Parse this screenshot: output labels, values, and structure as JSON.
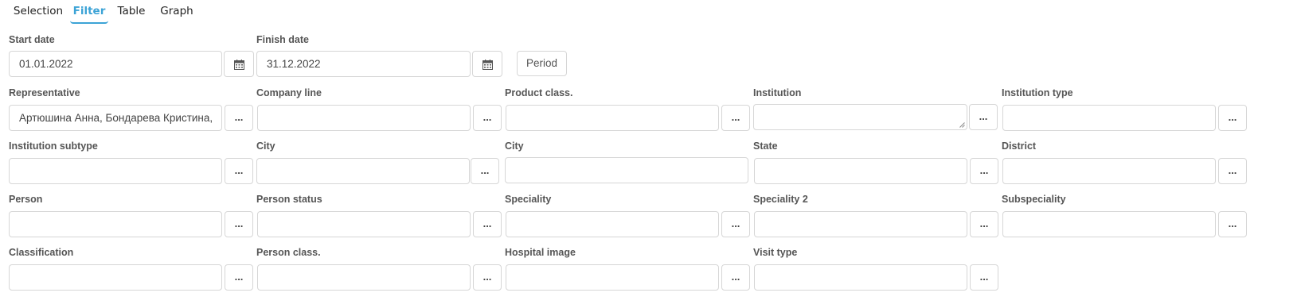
{
  "tabs": [
    {
      "label": "Selection",
      "active": false
    },
    {
      "label": "Filter",
      "active": true
    },
    {
      "label": "Table",
      "active": false
    },
    {
      "label": "Graph",
      "active": false
    }
  ],
  "dates": {
    "start_label": "Start date",
    "start_value": "01.01.2022",
    "finish_label": "Finish date",
    "finish_value": "31.12.2022",
    "period_label": "Period"
  },
  "filters": [
    {
      "label": "Representative",
      "value": "Артюшина Анна, Бондарева Кристина,",
      "button": "..."
    },
    {
      "label": "Company line",
      "value": "",
      "button": "..."
    },
    {
      "label": "Product class.",
      "value": "",
      "button": "..."
    },
    {
      "label": "Institution",
      "value": "",
      "button": "..."
    },
    {
      "label": "Institution type",
      "value": "",
      "button": "..."
    },
    {
      "label": "Institution subtype",
      "value": "",
      "button": "..."
    },
    {
      "label": "City",
      "value": "",
      "button": "..."
    },
    {
      "label": "City",
      "value": ""
    },
    {
      "label": "State",
      "value": "",
      "button": "..."
    },
    {
      "label": "District",
      "value": "",
      "button": "..."
    },
    {
      "label": "Person",
      "value": "",
      "button": "..."
    },
    {
      "label": "Person status",
      "value": "",
      "button": "..."
    },
    {
      "label": "Speciality",
      "value": "",
      "button": "..."
    },
    {
      "label": "Speciality 2",
      "value": "",
      "button": "..."
    },
    {
      "label": "Subspeciality",
      "value": "",
      "button": "..."
    },
    {
      "label": "Classification",
      "value": "",
      "button": "..."
    },
    {
      "label": "Person class.",
      "value": "",
      "button": "..."
    },
    {
      "label": "Hospital image",
      "value": "",
      "button": "..."
    },
    {
      "label": "Visit type",
      "value": "",
      "button": "..."
    }
  ],
  "icons": {
    "calendar": "calendar-icon",
    "resize": "resize-handle-icon"
  },
  "colors": {
    "accent": "#3ca3d6",
    "border": "#d6d6d6",
    "label": "#555555"
  }
}
